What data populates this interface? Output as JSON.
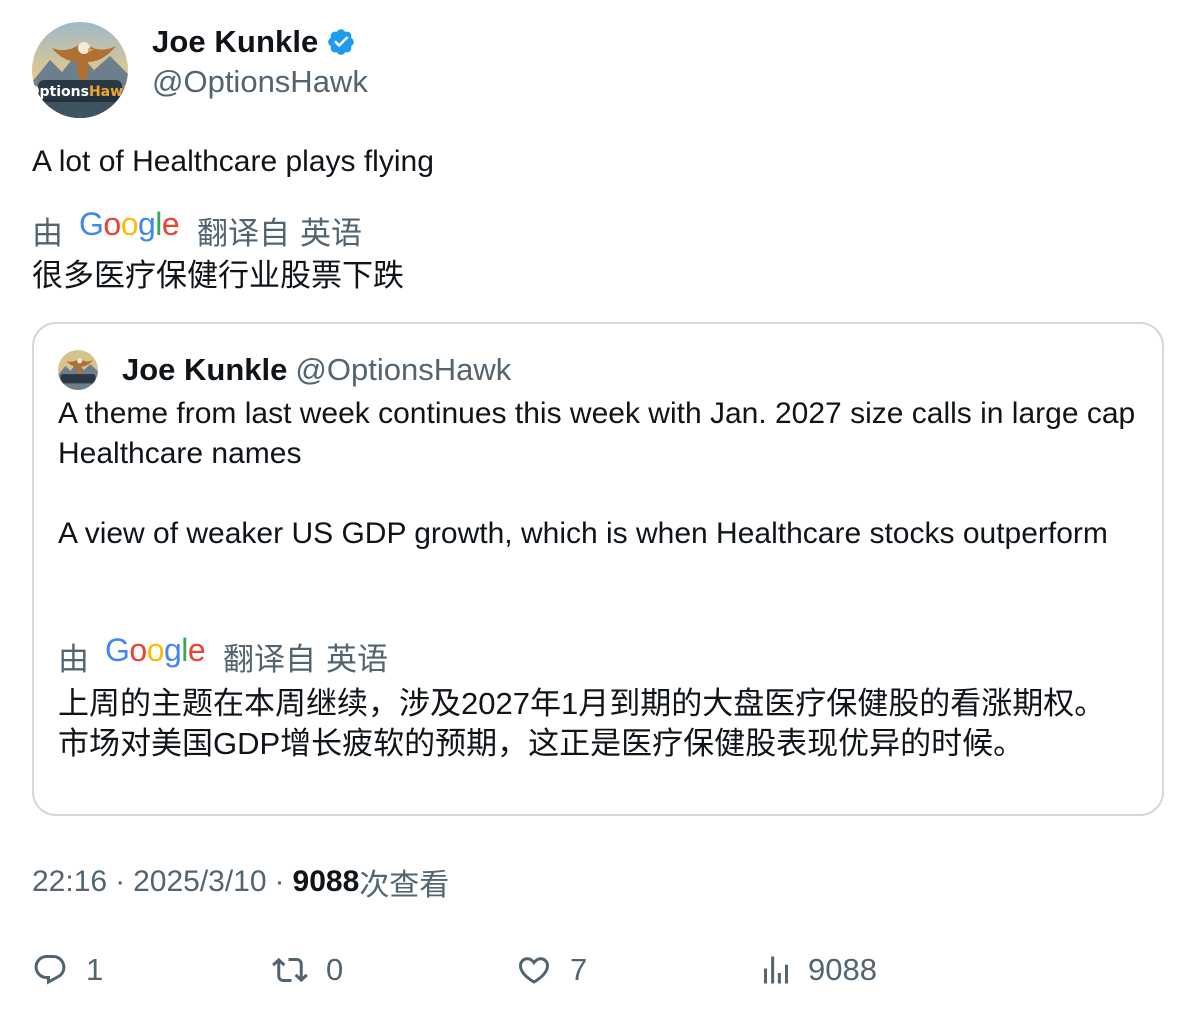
{
  "author": {
    "display_name": "Joe Kunkle",
    "handle": "@OptionsHawk",
    "verified": true,
    "avatar_text": "OptionsHawk"
  },
  "tweet": {
    "text": "A lot of Healthcare plays flying",
    "translate_by": "由",
    "translate_brand": "Google",
    "translate_from": "翻译自",
    "translate_lang": "英语",
    "translation": "很多医疗保健行业股票下跌"
  },
  "quote": {
    "display_name": "Joe Kunkle",
    "handle": "@OptionsHawk",
    "paragraph_1": "A theme from last week continues this week with Jan. 2027 size calls in large cap Healthcare names",
    "paragraph_2": "A view of weaker US GDP growth, which is when Healthcare stocks outperform",
    "translate_by": "由",
    "translate_brand": "Google",
    "translate_from": "翻译自",
    "translate_lang": "英语",
    "translation": "上周的主题在本周继续，涉及2027年1月到期的大盘医疗保健股的看涨期权。 市场对美国GDP增长疲软的预期，这正是医疗保健股表现优异的时候。"
  },
  "meta": {
    "time": "22:16",
    "separator": "·",
    "date": "2025/3/10",
    "views_count": "9088",
    "views_label": "次查看"
  },
  "actions": {
    "replies": "1",
    "reposts": "0",
    "likes": "7",
    "views": "9088"
  },
  "colors": {
    "text": "#0f1419",
    "secondary": "#536471",
    "verified": "#1d9bf0",
    "border": "#cfd9de",
    "google_blue": "#4285F4",
    "google_red": "#EA4335",
    "google_yellow": "#FBBC05",
    "google_green": "#34A853"
  },
  "icons": {
    "reply": "reply-icon",
    "repost": "repost-icon",
    "like": "like-icon",
    "views": "views-icon",
    "verified": "verified-badge-icon"
  }
}
